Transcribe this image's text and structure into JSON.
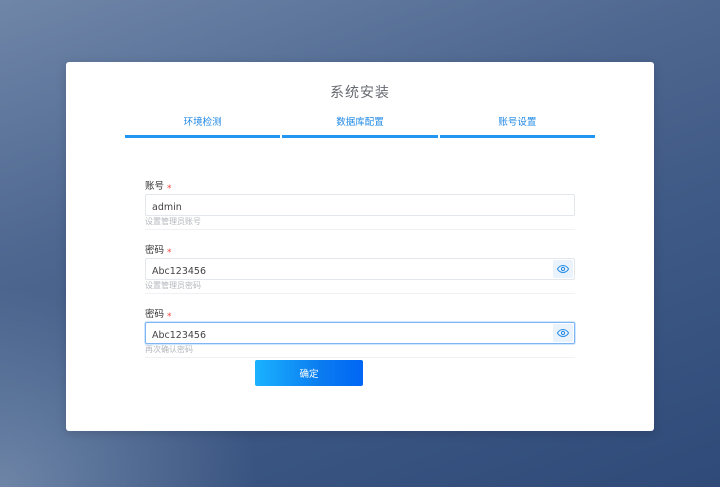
{
  "title": "系统安装",
  "steps": [
    {
      "label": "环境检测"
    },
    {
      "label": "数据库配置"
    },
    {
      "label": "账号设置"
    }
  ],
  "form": {
    "account": {
      "label": "账号",
      "required_mark": "*",
      "value": "admin",
      "hint": "设置管理员账号"
    },
    "password": {
      "label": "密码",
      "required_mark": "*",
      "value": "Abc123456",
      "hint": "设置管理员密码"
    },
    "confirm_password": {
      "label": "密码",
      "required_mark": "*",
      "value": "Abc123456",
      "hint": "再次确认密码"
    },
    "submit_label": "确定"
  },
  "colors": {
    "accent": "#2196f3",
    "required": "#f04134",
    "button_start": "#1ab2ff",
    "button_end": "#0066f5"
  },
  "icons": {
    "visibility": "eye-icon"
  }
}
